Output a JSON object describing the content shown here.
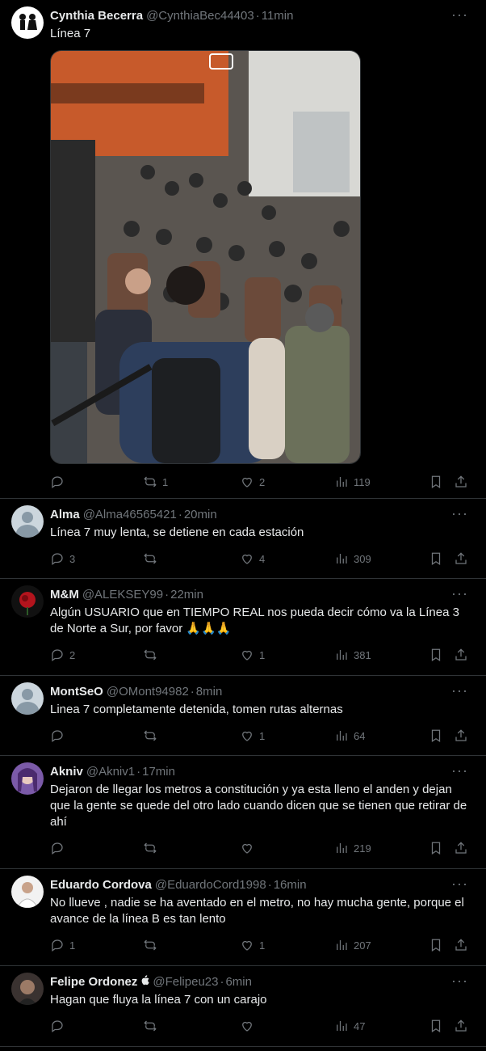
{
  "tweets": [
    {
      "name": "Cynthia Becerra",
      "handle": "@CynthiaBec44403",
      "time": "11min",
      "text": "Línea 7",
      "replies": "",
      "retweets": "1",
      "likes": "2",
      "views": "119"
    },
    {
      "name": "Alma",
      "handle": "@Alma46565421",
      "time": "20min",
      "text": "Línea 7 muy lenta, se detiene en cada estación",
      "replies": "3",
      "retweets": "",
      "likes": "4",
      "views": "309"
    },
    {
      "name": "M&M",
      "handle": "@ALEKSEY99",
      "time": "22min",
      "text": "Algún USUARIO que en TIEMPO REAL nos pueda decir cómo va la Línea 3 de Norte a Sur, por favor 🙏🙏🙏",
      "replies": "2",
      "retweets": "",
      "likes": "1",
      "views": "381"
    },
    {
      "name": "MontSeO",
      "handle": "@OMont94982",
      "time": "8min",
      "text": "Linea 7 completamente detenida, tomen rutas alternas",
      "replies": "",
      "retweets": "",
      "likes": "1",
      "views": "64"
    },
    {
      "name": "Akniv",
      "handle": "@Akniv1",
      "time": "17min",
      "text": "Dejaron de llegar los metros a constitución y ya esta lleno el anden y dejan que la gente se quede del otro lado cuando dicen que se tienen que retirar de ahí",
      "replies": "",
      "retweets": "",
      "likes": "",
      "views": "219"
    },
    {
      "name": "Eduardo Cordova",
      "handle": "@EduardoCord1998",
      "time": "16min",
      "text": "No llueve , nadie se ha aventado en el metro, no hay mucha gente, porque el avance de la línea B es tan lento",
      "replies": "1",
      "retweets": "",
      "likes": "1",
      "views": "207"
    },
    {
      "name": "Felipe Ordonez",
      "handle": "@Felipeu23",
      "time": "6min",
      "text": "Hagan que fluya la línea 7 con un carajo",
      "replies": "",
      "retweets": "",
      "likes": "",
      "views": "47"
    }
  ],
  "more_label": "···",
  "separator": "·"
}
